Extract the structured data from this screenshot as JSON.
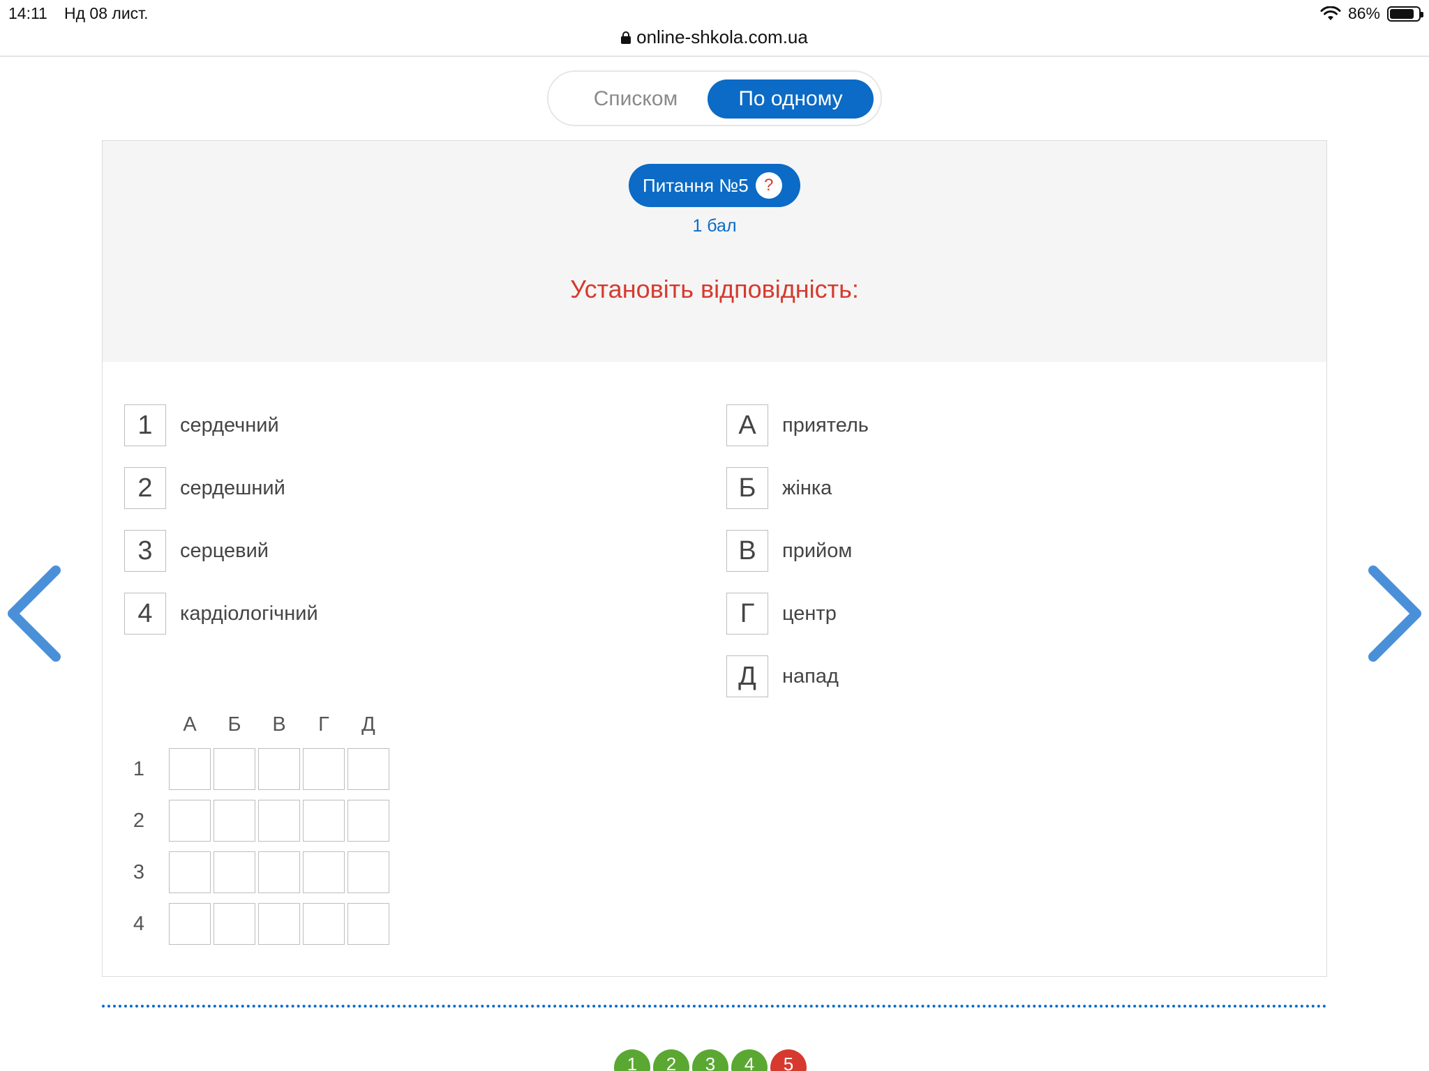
{
  "status_bar": {
    "time": "14:11",
    "date": "Нд 08 лист.",
    "battery": "86%"
  },
  "browser": {
    "url": "online-shkola.com.ua"
  },
  "view_toggle": {
    "list_label": "Списком",
    "single_label": "По одному"
  },
  "question": {
    "badge": "Питання №5",
    "help": "?",
    "points": "1 бал",
    "instruction": "Установіть відповідність:"
  },
  "left_items": [
    {
      "key": "1",
      "text": "сердечний"
    },
    {
      "key": "2",
      "text": "сердешний"
    },
    {
      "key": "3",
      "text": "серцевий"
    },
    {
      "key": "4",
      "text": "кардіологічний"
    }
  ],
  "right_items": [
    {
      "key": "А",
      "text": "приятель"
    },
    {
      "key": "Б",
      "text": "жінка"
    },
    {
      "key": "В",
      "text": "прийом"
    },
    {
      "key": "Г",
      "text": "центр"
    },
    {
      "key": "Д",
      "text": "напад"
    }
  ],
  "grid": {
    "columns": [
      "А",
      "Б",
      "В",
      "Г",
      "Д"
    ],
    "rows": [
      "1",
      "2",
      "3",
      "4"
    ]
  },
  "pagination": [
    {
      "label": "1",
      "color": "#5aa832"
    },
    {
      "label": "2",
      "color": "#5aa832"
    },
    {
      "label": "3",
      "color": "#5aa832"
    },
    {
      "label": "4",
      "color": "#5aa832"
    },
    {
      "label": "5",
      "color": "#d63a2f"
    }
  ],
  "colors": {
    "accent": "#0b6bc6",
    "instruction": "#d63a2f",
    "arrow": "#4a90d9"
  }
}
